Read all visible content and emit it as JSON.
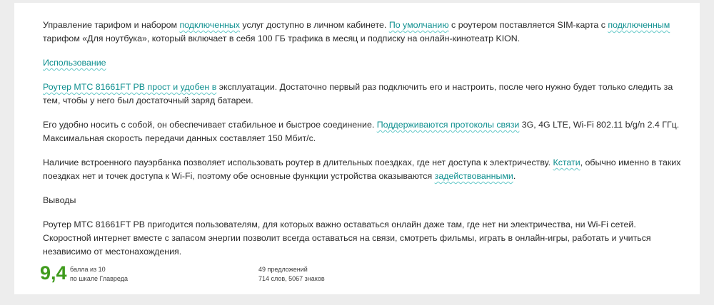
{
  "paragraphs": [
    [
      {
        "t": "Управление тарифом и набором "
      },
      {
        "t": "подключенных",
        "hl": true
      },
      {
        "t": " услуг доступно в личном кабинете. "
      },
      {
        "t": "По умолчанию",
        "hl": true
      },
      {
        "t": " с роутером поставляется SIM-карта с "
      },
      {
        "t": "подключенным",
        "hl": true
      },
      {
        "t": " тарифом «Для ноутбука», который включает в себя 100 ГБ трафика в месяц и подписку на онлайн-кинотеатр KION."
      }
    ],
    [
      {
        "t": "Использование",
        "hl": true
      }
    ],
    [
      {
        "t": "Роутер МТС 81661FT PB прост и удобен в",
        "hl": true
      },
      {
        "t": " эксплуатации. Достаточно первый раз подключить его и настроить, после чего нужно будет только следить за тем, чтобы у него был достаточный заряд батареи."
      }
    ],
    [
      {
        "t": "Его удобно носить с собой, он обеспечивает стабильное и быстрое соединение. "
      },
      {
        "t": "Поддерживаются протоколы связи",
        "hl": true
      },
      {
        "t": " 3G, 4G LTE, Wi-Fi 802.11 b/g/n 2.4 ГГц. Максимальная скорость передачи данных составляет 150 Мбит/с."
      }
    ],
    [
      {
        "t": "Наличие встроенного пауэрбанка позволяет использовать роутер в длительных поездках, где нет доступа к электричеству. "
      },
      {
        "t": "Кстати",
        "hl": true
      },
      {
        "t": ", обычно именно в таких поездках нет и точек доступа к Wi-Fi, поэтому обе основные функции устройства оказываются "
      },
      {
        "t": "задействованными",
        "hl": true
      },
      {
        "t": "."
      }
    ],
    [
      {
        "t": "Выводы"
      }
    ],
    [
      {
        "t": "Роутер МТС 81661FT PB пригодится пользователям, для которых важно оставаться онлайн даже там, где нет ни электричества, ни Wi-Fi сетей. Скоростной интернет вместе с запасом энергии позволит всегда оставаться на связи, смотреть фильмы, играть в онлайн-игры, работать и учиться независимо от местонахождения."
      }
    ]
  ],
  "result": {
    "score": "9,4",
    "caption_line1": "балла из 10",
    "caption_line2": "по шкале Главреда",
    "stats_line1": "49 предложений",
    "stats_line2": "714 слов, 5067 знаков"
  },
  "colors": {
    "highlight_text": "#0e8f8f",
    "highlight_underline": "#63c8c8",
    "score": "#3f9b1c",
    "background": "#ededed"
  }
}
